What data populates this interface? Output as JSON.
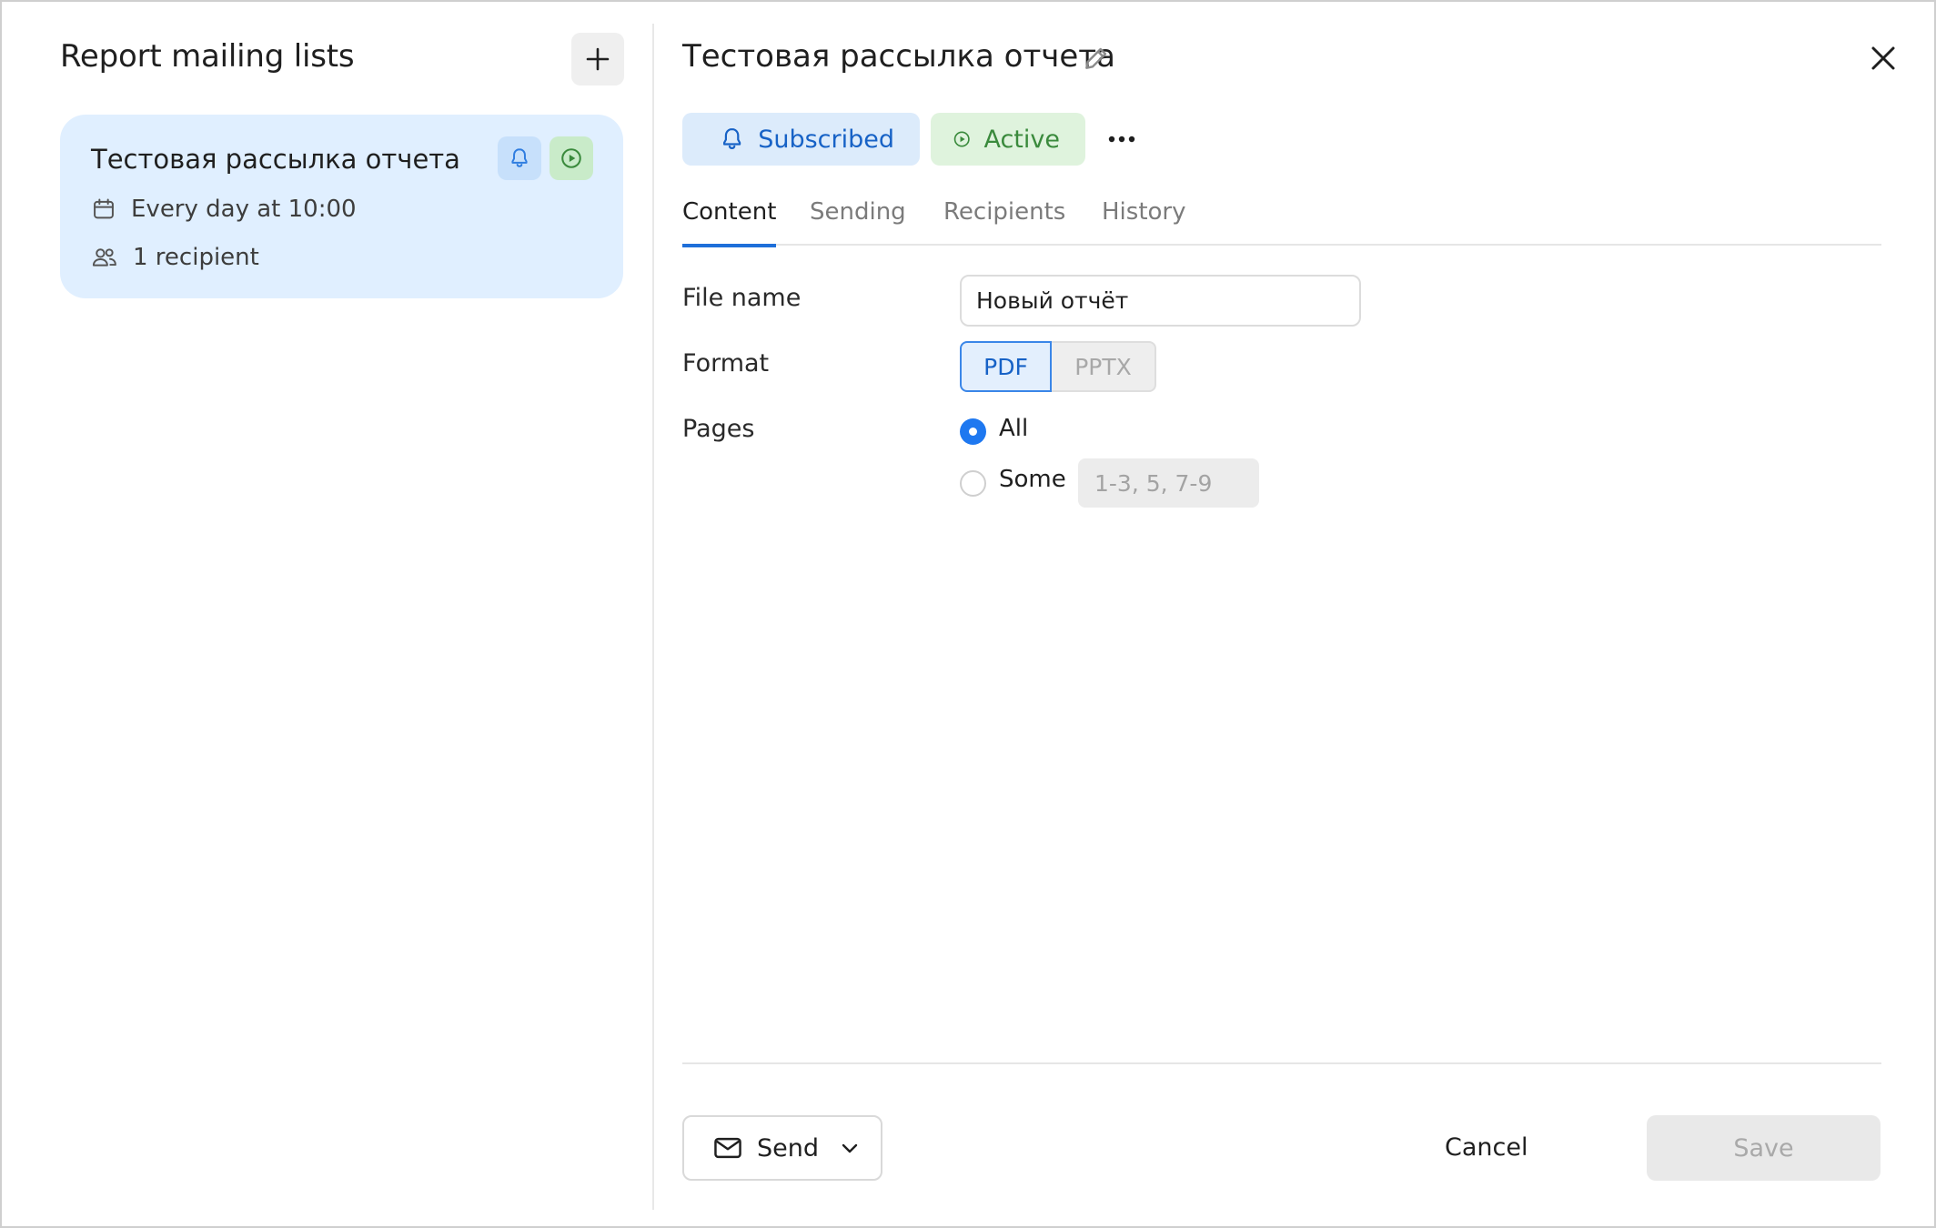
{
  "sidebar": {
    "title": "Report mailing lists",
    "add_icon": "plus-icon",
    "items": [
      {
        "title": "Тестовая рассылка отчета",
        "schedule": "Every day at 10:00",
        "recipients": "1 recipient",
        "icons": [
          "bell-icon",
          "play-icon",
          "calendar-icon",
          "users-icon"
        ]
      }
    ]
  },
  "detail": {
    "title": "Тестовая рассылка отчета",
    "status": {
      "subscribed": "Subscribed",
      "active": "Active"
    },
    "tabs": [
      {
        "label": "Content",
        "active": true
      },
      {
        "label": "Sending",
        "active": false
      },
      {
        "label": "Recipients",
        "active": false
      },
      {
        "label": "History",
        "active": false
      }
    ],
    "form": {
      "file_name_label": "File name",
      "file_name_value": "Новый отчёт",
      "format_label": "Format",
      "format_options": [
        "PDF",
        "PPTX"
      ],
      "format_selected": "PDF",
      "pages_label": "Pages",
      "pages_all": "All",
      "pages_some": "Some",
      "pages_selected": "All",
      "pages_placeholder": "1-3, 5, 7-9"
    },
    "footer": {
      "send": "Send",
      "cancel": "Cancel",
      "save": "Save"
    }
  },
  "colors": {
    "accent_blue": "#1e6fd9",
    "subscribed_bg": "#dcebfb",
    "active_bg": "#dff3dd",
    "card_bg": "#e0efff"
  }
}
